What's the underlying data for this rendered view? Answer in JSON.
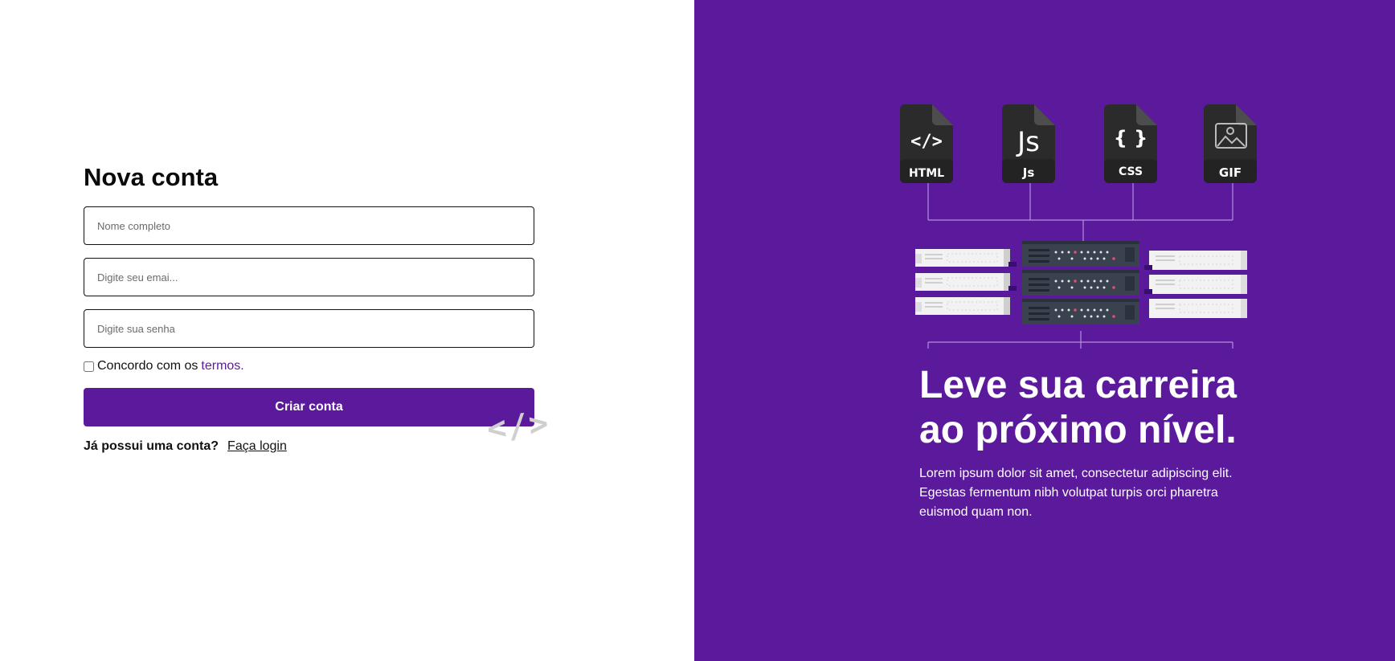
{
  "form": {
    "title": "Nova conta",
    "name_placeholder": "Nome completo",
    "email_placeholder": "Digite seu emai...",
    "password_placeholder": "Digite sua senha",
    "terms_text": "Concordo com os",
    "terms_link": "termos.",
    "submit_label": "Criar conta",
    "login_question": "Já possui uma conta?",
    "login_link": "Faça login",
    "decoration_text": "</>"
  },
  "hero": {
    "file_icons": [
      {
        "label": "HTML",
        "glyph": "</>"
      },
      {
        "label": "Js",
        "glyph": "Js"
      },
      {
        "label": "CSS",
        "glyph": "{ }"
      },
      {
        "label": "GIF",
        "glyph": "image-icon"
      }
    ],
    "headline_line1": "Leve sua carreira",
    "headline_line2": "ao próximo nível.",
    "description": "Lorem ipsum dolor sit amet, consectetur adipiscing elit. Egestas fermentum nibh volutpat turpis orci pharetra euismod quam non."
  },
  "colors": {
    "brand": "#5b1a9b",
    "file_icon": "#2b2b2b",
    "server_dark": "#3a4250",
    "server_light": "#f2f2f2"
  }
}
